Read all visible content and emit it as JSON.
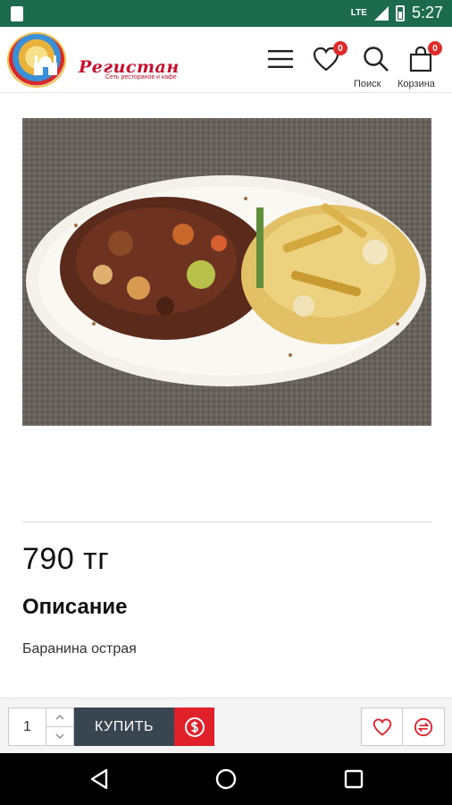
{
  "status_bar": {
    "network": "LTE",
    "time": "5:27"
  },
  "header": {
    "brand_name": "Регистан",
    "brand_subtitle": "Сеть ресторанов и кафе",
    "wishlist_count": "0",
    "cart_count": "0",
    "search_label": "Поиск",
    "cart_label": "Корзина"
  },
  "product": {
    "image_icon": "plated-lamb-dish-photo",
    "price": "790 тг",
    "description_title": "Описание",
    "description_text": "Баранина острая"
  },
  "buy_bar": {
    "quantity": "1",
    "buy_label": "КУПИТЬ"
  },
  "colors": {
    "status_bar": "#1c6b4f",
    "brand": "#c8102e",
    "badge": "#e02b2b",
    "buy_button": "#3a4552",
    "one_click": "#e0212b"
  }
}
